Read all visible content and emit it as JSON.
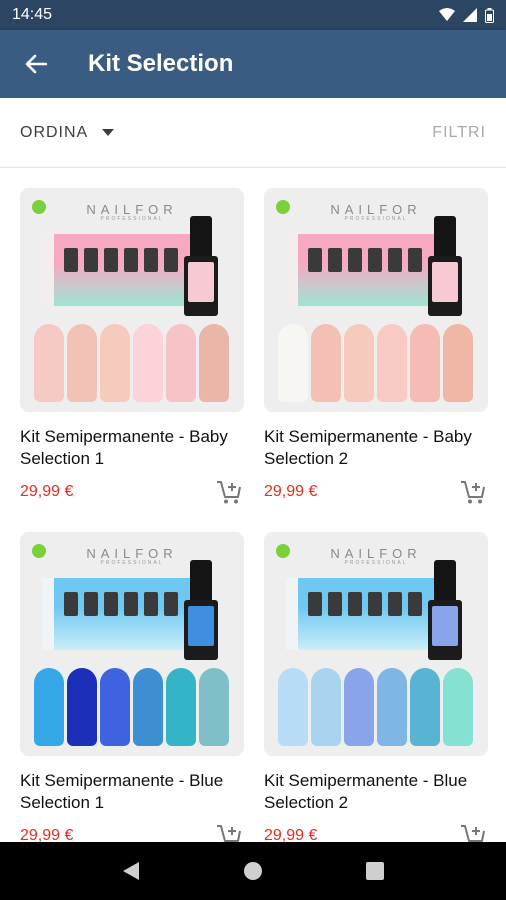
{
  "status_bar": {
    "time": "14:45",
    "icons": [
      "wifi-icon",
      "signal-icon",
      "battery-icon"
    ]
  },
  "app_bar": {
    "title": "Kit Selection",
    "back_icon": "arrow-back-icon"
  },
  "toolbar": {
    "sort_label": "ORDINA",
    "filter_label": "FILTRI"
  },
  "colors": {
    "app_bar": "#3a5b82",
    "status_bar": "#2b4563",
    "price": "#e02f1f",
    "available_dot": "#7ad13a"
  },
  "image_brand": {
    "name": "NAILFOR",
    "tagline": "PROFESSIONAL"
  },
  "products": [
    {
      "name": "Kit Semipermanente - Baby Selection 1",
      "price": "29,99 €",
      "available": true,
      "palette": [
        "#f7c9c6",
        "#f3c2b6",
        "#f6cbbd",
        "#fbd3d8",
        "#f7c3c6",
        "#e9b6a8"
      ],
      "box_colors": [
        "#f7a9c2",
        "#9fe4d4"
      ]
    },
    {
      "name": "Kit Semipermanente - Baby Selection 2",
      "price": "29,99 €",
      "available": true,
      "palette": [
        "#f8f6f3",
        "#f4c0b6",
        "#f6cbbd",
        "#f9c9c3",
        "#f7bbb6",
        "#f0b7a7"
      ],
      "box_colors": [
        "#f7a9c2",
        "#9fe4d4"
      ]
    },
    {
      "name": "Kit Semipermanente - Blue Selection 1",
      "price": "29,99 €",
      "available": true,
      "palette": [
        "#36a7e6",
        "#1b2fb8",
        "#3f63e0",
        "#3d8fd2",
        "#34b5c7",
        "#7fc0c8"
      ],
      "box_colors": [
        "#6fc8f2",
        "#c9eef8"
      ]
    },
    {
      "name": "Kit Semipermanente - Blue Selection 2",
      "price": "29,99 €",
      "available": true,
      "palette": [
        "#b8dcf6",
        "#a8d4ef",
        "#8aa4ec",
        "#7fb6e6",
        "#58b4d2",
        "#85e2d2"
      ],
      "box_colors": [
        "#6fc8f2",
        "#c9eef8"
      ]
    }
  ],
  "nav_bar": {
    "buttons": [
      "back-triangle-icon",
      "home-circle-icon",
      "recents-square-icon"
    ]
  }
}
